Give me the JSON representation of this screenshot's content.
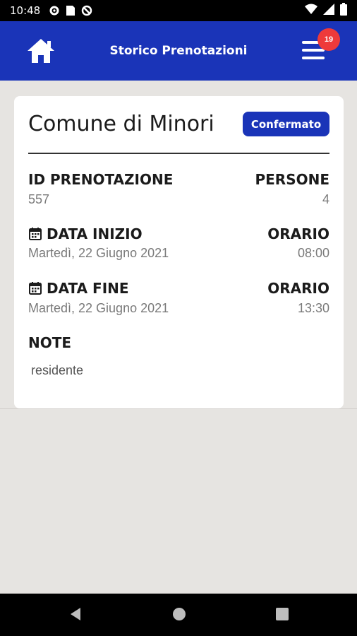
{
  "status_bar": {
    "time": "10:48"
  },
  "header": {
    "title": "Storico Prenotazioni",
    "notification_count": "19"
  },
  "card": {
    "venue": "Comune di Minori",
    "status": "Confermato",
    "booking_id_label": "ID PRENOTAZIONE",
    "booking_id_value": "557",
    "people_label": "PERSONE",
    "people_value": "4",
    "start_date_label": "DATA INIZIO",
    "start_date_value": "Martedì, 22 Giugno 2021",
    "start_time_label": "ORARIO",
    "start_time_value": "08:00",
    "end_date_label": "DATA FINE",
    "end_date_value": "Martedì, 22 Giugno 2021",
    "end_time_label": "ORARIO",
    "end_time_value": "13:30",
    "note_label": "NOTE",
    "note_value": "residente"
  },
  "colors": {
    "primary": "#1a34b8",
    "badge": "#ee3a3a",
    "background": "#e6e4e1"
  },
  "icons": [
    "settings-icon",
    "sim-icon",
    "data-saver-icon",
    "wifi-icon",
    "signal-icon",
    "battery-icon",
    "home-icon",
    "menu-icon",
    "calendar-icon",
    "nav-back-icon",
    "nav-home-icon",
    "nav-recents-icon"
  ]
}
